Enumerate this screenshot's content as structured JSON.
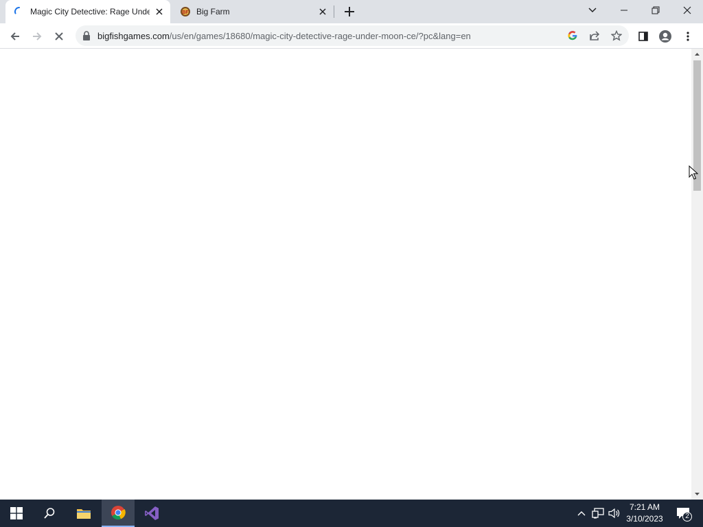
{
  "browser": {
    "tabs": [
      {
        "title": "Magic City Detective: Rage Under the Moon Collector's Edition",
        "display": "Magic City Detective: Rage Unde",
        "loading": true
      },
      {
        "title": "Big Farm",
        "display": "Big Farm",
        "favicon": "big-farm-favicon"
      }
    ],
    "url_host": "bigfishgames.com",
    "url_path": "/us/en/games/18680/magic-city-detective-rage-under-moon-ce/?pc&lang=en"
  },
  "taskbar": {
    "time": "7:21 AM",
    "date": "3/10/2023",
    "notification_count": "2"
  },
  "colors": {
    "tabbar_bg": "#dee1e6",
    "taskbar_bg": "#1c2636",
    "accent": "#1a73e8"
  }
}
